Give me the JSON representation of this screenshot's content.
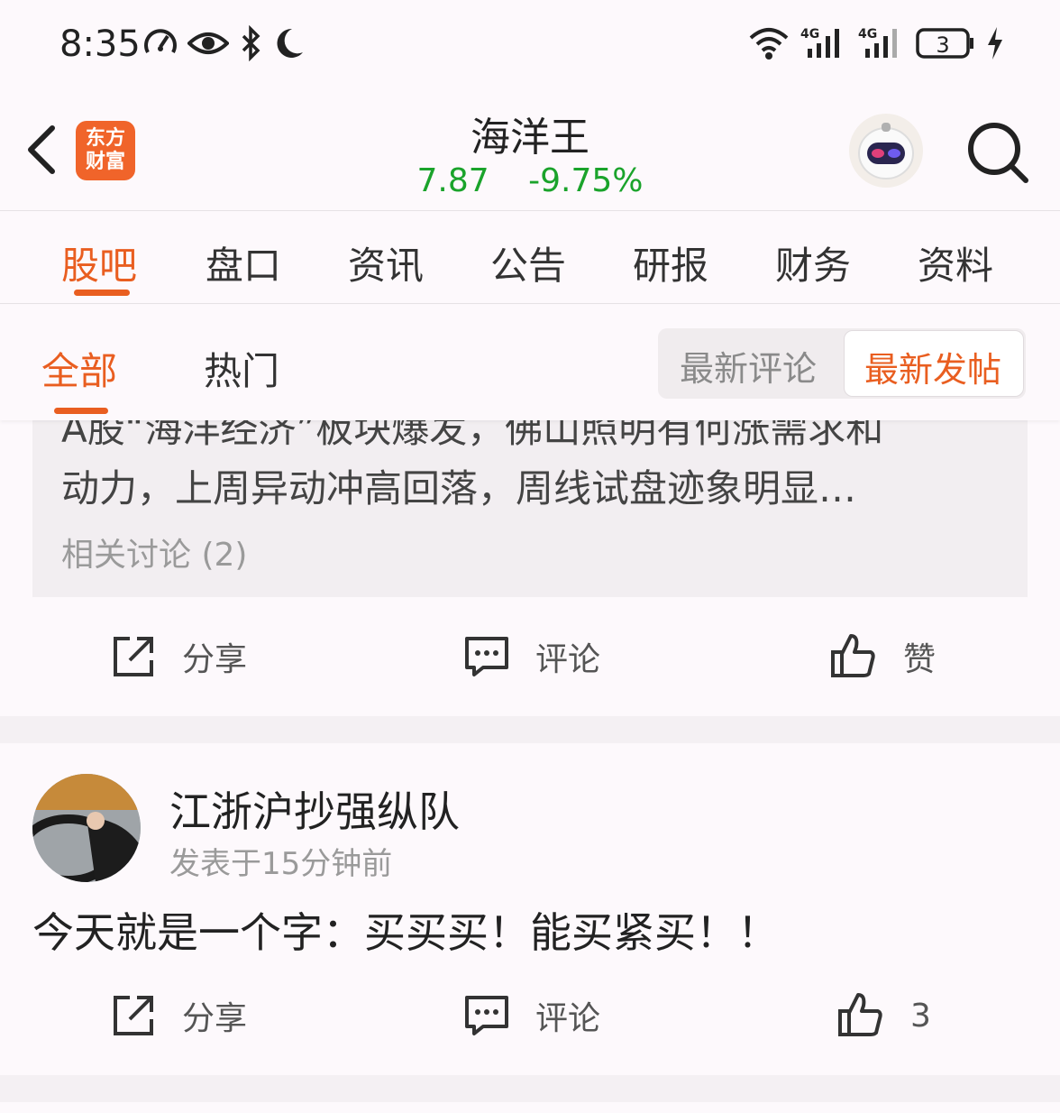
{
  "status_bar": {
    "time": "8:35",
    "left_icons": [
      "speedometer-icon",
      "eye-icon",
      "bluetooth-icon",
      "moon-icon"
    ],
    "right_icons": [
      "wifi-icon",
      "signal-4g-icon",
      "signal-4g-icon",
      "battery-icon",
      "charging-icon"
    ],
    "network1": "4G",
    "network2": "4G",
    "battery": "3"
  },
  "header": {
    "logo_text_line1": "东方",
    "logo_text_line2": "财富",
    "stock_name": "海洋王",
    "price": "7.87",
    "change": "-9.75%",
    "price_color": "#1aa32b"
  },
  "tabs": [
    {
      "label": "股吧",
      "active": true
    },
    {
      "label": "盘口",
      "active": false
    },
    {
      "label": "资讯",
      "active": false
    },
    {
      "label": "公告",
      "active": false
    },
    {
      "label": "研报",
      "active": false
    },
    {
      "label": "财务",
      "active": false
    },
    {
      "label": "资料",
      "active": false
    }
  ],
  "subtabs": [
    {
      "label": "全部",
      "active": true
    },
    {
      "label": "热门",
      "active": false
    }
  ],
  "sort_options": [
    {
      "label": "最新评论",
      "active": false
    },
    {
      "label": "最新发帖",
      "active": true
    }
  ],
  "quote_box": {
    "line1_partial": "A股“海洋经济”板块爆发，佛山照明有何涨需求和",
    "line2": "动力，上周异动冲高回落，周线试盘迹象明显…",
    "related": "相关讨论 (2)"
  },
  "actions1": {
    "share": "分享",
    "comment": "评论",
    "like": "赞"
  },
  "post": {
    "author": "江浙沪抄强纵队",
    "time": "发表于15分钟前",
    "body": "今天就是一个字：买买买！能买紧买！！",
    "share": "分享",
    "comment": "评论",
    "likes": "3"
  },
  "accent_color": "#e95e20"
}
